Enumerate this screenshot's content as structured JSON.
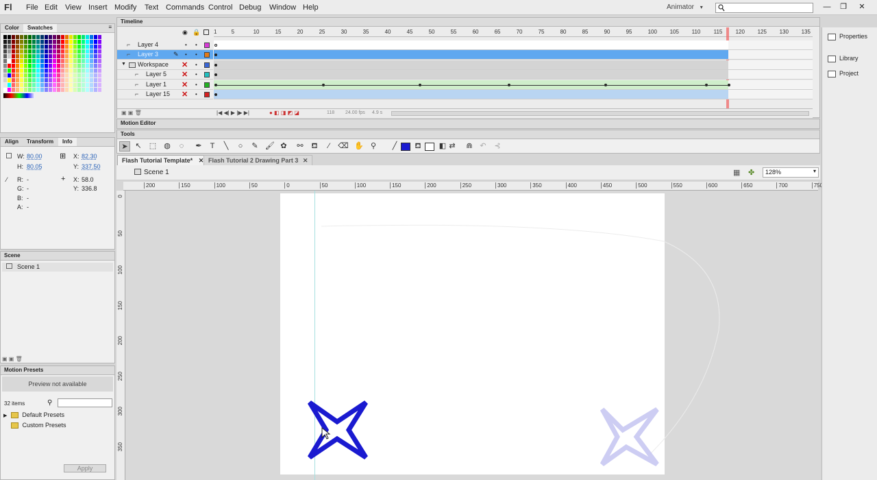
{
  "app": {
    "logo": "Fl"
  },
  "menu": [
    "File",
    "Edit",
    "View",
    "Insert",
    "Modify",
    "Text",
    "Commands",
    "Control",
    "Debug",
    "Window",
    "Help"
  ],
  "workspace": {
    "label": "Animator",
    "arrow": "▾",
    "search_icon": "magnifier-icon"
  },
  "window_buttons": [
    "—",
    "❐",
    "✕"
  ],
  "color_panel": {
    "tabs": [
      "Color",
      "Swatches"
    ]
  },
  "info_panel": {
    "tabs": [
      "Align",
      "Transform",
      "Info"
    ],
    "w_label": "W:",
    "w": "80.00",
    "h_label": "H:",
    "h": "80.05",
    "x_label": "X:",
    "x": "82.30",
    "y_label": "Y:",
    "y": "337.50",
    "r_label": "R:",
    "r": "-",
    "g_label": "G:",
    "g": "-",
    "b_label": "B:",
    "b": "-",
    "a_label": "A:",
    "a": "-",
    "cx_label": "X:",
    "cx": "58.0",
    "cy_label": "Y:",
    "cy": "336.8"
  },
  "scene_panel": {
    "title": "Scene",
    "item": "Scene 1"
  },
  "motion_presets": {
    "title": "Motion Presets",
    "preview": "Preview not available",
    "count": "32 items",
    "folders": [
      "Default Presets",
      "Custom Presets"
    ],
    "apply": "Apply"
  },
  "right_panel": {
    "items": [
      "Properties",
      "Library",
      "Project"
    ]
  },
  "timeline": {
    "title": "Timeline",
    "frame_numbers": [
      "1",
      "5",
      "10",
      "15",
      "20",
      "25",
      "30",
      "35",
      "40",
      "45",
      "50",
      "55",
      "60",
      "65",
      "70",
      "75",
      "80",
      "85",
      "90",
      "95",
      "100",
      "105",
      "110",
      "115",
      "120",
      "125",
      "130",
      "135"
    ],
    "layers": [
      {
        "name": "Layer 4",
        "color": "#d63bd6"
      },
      {
        "name": "Layer 3",
        "color": "#e07a1a",
        "selected": true
      },
      {
        "name": "Workspace",
        "color": "#3a66d6",
        "folder": true
      },
      {
        "name": "Layer 5",
        "color": "#22c0c0",
        "hidden": true
      },
      {
        "name": "Layer 1",
        "color": "#22b022",
        "hidden": true
      },
      {
        "name": "Layer 15",
        "color": "#d62222",
        "hidden": true
      }
    ],
    "status_frame": "118",
    "status_fps": "24.00 fps",
    "status_time": "4.9 s"
  },
  "motion_editor": {
    "title": "Motion Editor"
  },
  "tools": {
    "title": "Tools",
    "items": [
      "selection-tool",
      "subselection-tool",
      "free-transform-tool",
      "3d-rotation-tool",
      "lasso-tool",
      "pen-tool",
      "text-tool",
      "line-tool",
      "oval-tool",
      "pencil-tool",
      "brush-tool",
      "deco-tool",
      "bone-tool",
      "paint-bucket-tool",
      "eyedropper-tool",
      "eraser-tool",
      "hand-tool",
      "zoom-tool",
      "stroke-color",
      "fill-color"
    ],
    "stroke_color": "#1a1ad0",
    "fill_color": "#ffffff"
  },
  "documents": {
    "tabs": [
      "Flash Tutorial Template*",
      "Flash Tutorial 2 Drawing Part 3"
    ],
    "close": "✕"
  },
  "scene_bar": {
    "scene": "Scene 1",
    "zoom": "128%"
  },
  "ruler": {
    "top": [
      "200",
      "150",
      "100",
      "50",
      "0",
      "50",
      "100",
      "150",
      "200",
      "250",
      "300",
      "350",
      "400",
      "450",
      "500",
      "550",
      "600",
      "650",
      "700",
      "750"
    ],
    "left": [
      "0",
      "50",
      "100",
      "150",
      "200",
      "250",
      "300",
      "350"
    ]
  },
  "stage": {
    "star_color": "#1a1ad0",
    "onion_star_color": "#b8b8ee"
  }
}
